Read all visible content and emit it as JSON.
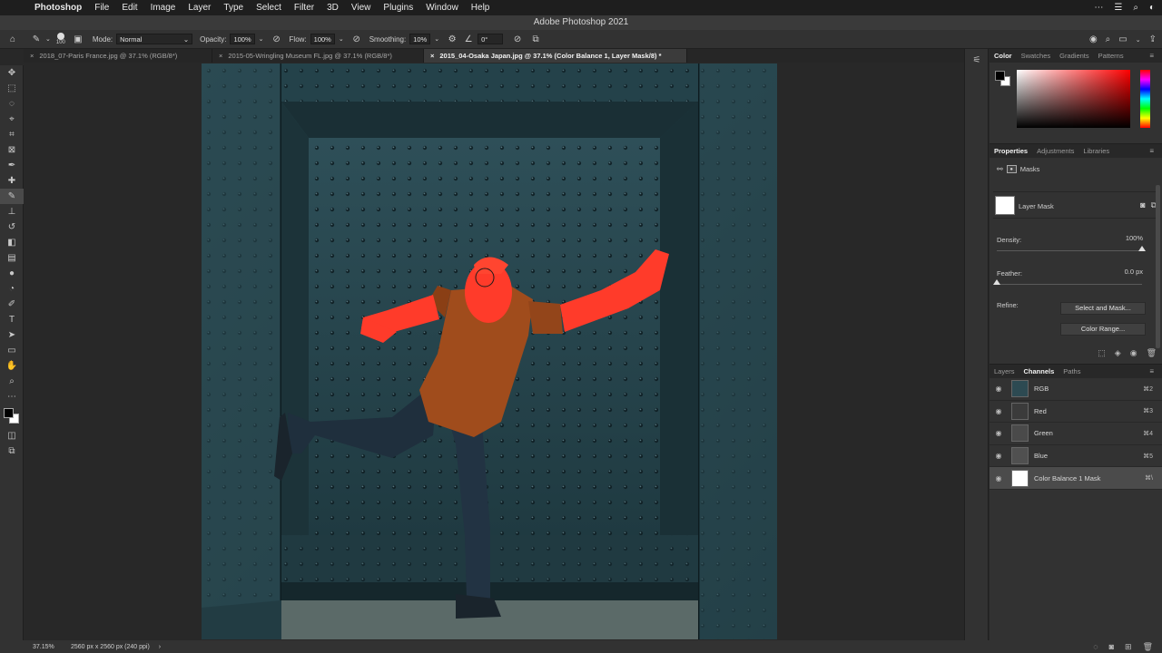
{
  "menubar": {
    "apple_icon": "apple-icon",
    "app_name": "Photoshop",
    "items": [
      "File",
      "Edit",
      "Image",
      "Layer",
      "Type",
      "Select",
      "Filter",
      "3D",
      "View",
      "Plugins",
      "Window",
      "Help"
    ]
  },
  "window_title": "Adobe Photoshop 2021",
  "options": {
    "brush_size": "100",
    "mode_label": "Mode:",
    "mode_value": "Normal",
    "opacity_label": "Opacity:",
    "opacity_value": "100%",
    "flow_label": "Flow:",
    "flow_value": "100%",
    "smoothing_label": "Smoothing:",
    "smoothing_value": "10%",
    "angle_value": "0°"
  },
  "tabs": [
    {
      "label": "2018_07-Paris France.jpg @ 37.1% (RGB/8*)",
      "active": false
    },
    {
      "label": "2015-05-Wringling Museum FL.jpg @ 37.1% (RGB/8*)",
      "active": false
    },
    {
      "label": "2015_04-Osaka Japan.jpg @ 37.1% (Color Balance 1, Layer Mask/8) *",
      "active": true
    }
  ],
  "status": {
    "zoom": "37.15%",
    "doc_size": "2560 px x 2560 px (240 ppi)"
  },
  "color_panel": {
    "tabs": [
      "Color",
      "Swatches",
      "Gradients",
      "Patterns"
    ],
    "active_tab": "Color",
    "foreground": "#000000",
    "background": "#ffffff",
    "hue_color": "#ff0000"
  },
  "properties_panel": {
    "tabs": [
      "Properties",
      "Adjustments",
      "Libraries"
    ],
    "active_tab": "Properties",
    "masks_label": "Masks",
    "layer_mask_label": "Layer Mask",
    "density_label": "Density:",
    "density_value": "100%",
    "feather_label": "Feather:",
    "feather_value": "0.0 px",
    "refine_label": "Refine:",
    "select_and_mask": "Select and Mask...",
    "color_range": "Color Range..."
  },
  "channels_panel": {
    "tabs": [
      "Layers",
      "Channels",
      "Paths"
    ],
    "active_tab": "Channels",
    "channels": [
      {
        "name": "RGB",
        "shortcut": "⌘2",
        "selected": false
      },
      {
        "name": "Red",
        "shortcut": "⌘3",
        "selected": false
      },
      {
        "name": "Green",
        "shortcut": "⌘4",
        "selected": false
      },
      {
        "name": "Blue",
        "shortcut": "⌘5",
        "selected": false
      },
      {
        "name": "Color Balance 1 Mask",
        "shortcut": "⌘\\",
        "selected": true
      }
    ]
  },
  "colors": {
    "overlay": "#ff3b2a",
    "wall": "#2c4a52"
  }
}
